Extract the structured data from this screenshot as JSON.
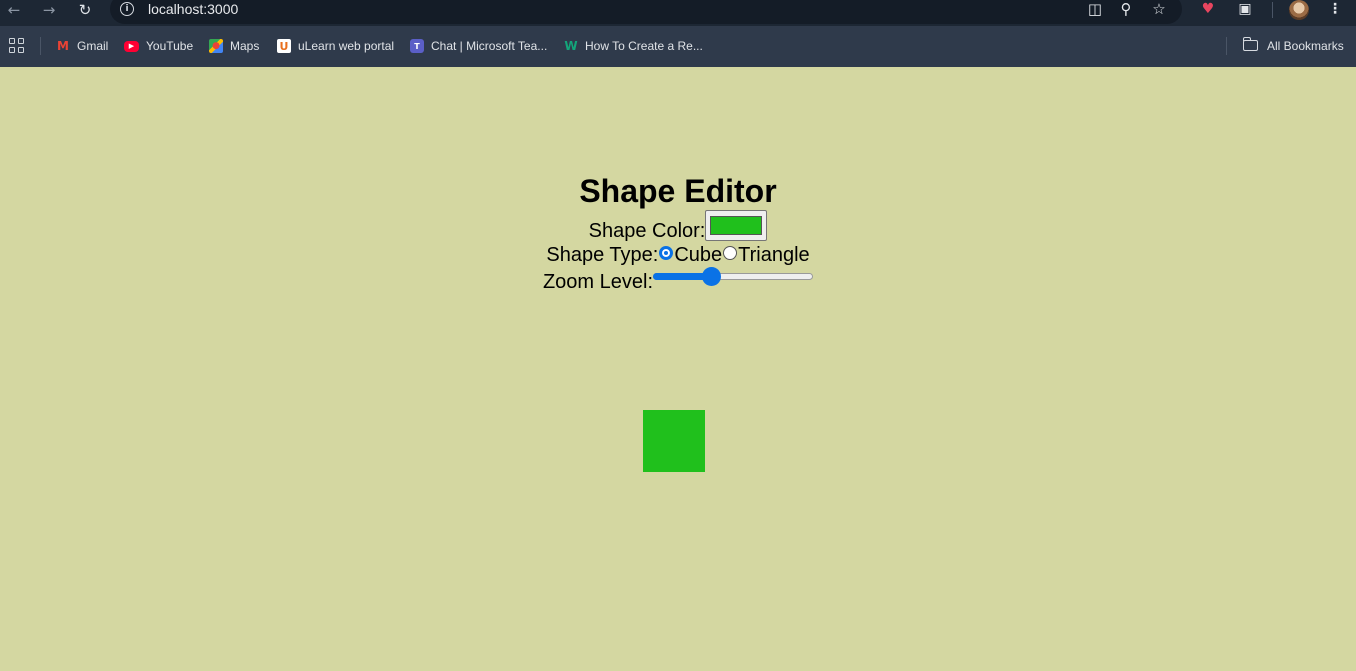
{
  "browser": {
    "url": "localhost:3000",
    "bookmarks": [
      {
        "label": "Gmail",
        "icon": "gmail-icon"
      },
      {
        "label": "YouTube",
        "icon": "youtube-icon"
      },
      {
        "label": "Maps",
        "icon": "maps-icon"
      },
      {
        "label": "uLearn web portal",
        "icon": "ulearn-icon"
      },
      {
        "label": "Chat | Microsoft Tea...",
        "icon": "teams-icon"
      },
      {
        "label": "How To Create a Re...",
        "icon": "w-icon"
      }
    ],
    "all_bookmarks_label": "All Bookmarks"
  },
  "editor": {
    "title": "Shape Editor",
    "color_label": "Shape Color:",
    "color_value": "#20c01c",
    "type_label": "Shape Type:",
    "type_options": [
      {
        "label": "Cube",
        "checked": true
      },
      {
        "label": "Triangle",
        "checked": false
      }
    ],
    "zoom_label": "Zoom Level:",
    "zoom_fraction": 0.35
  },
  "shape": {
    "type": "Cube",
    "color": "#20c01c"
  }
}
